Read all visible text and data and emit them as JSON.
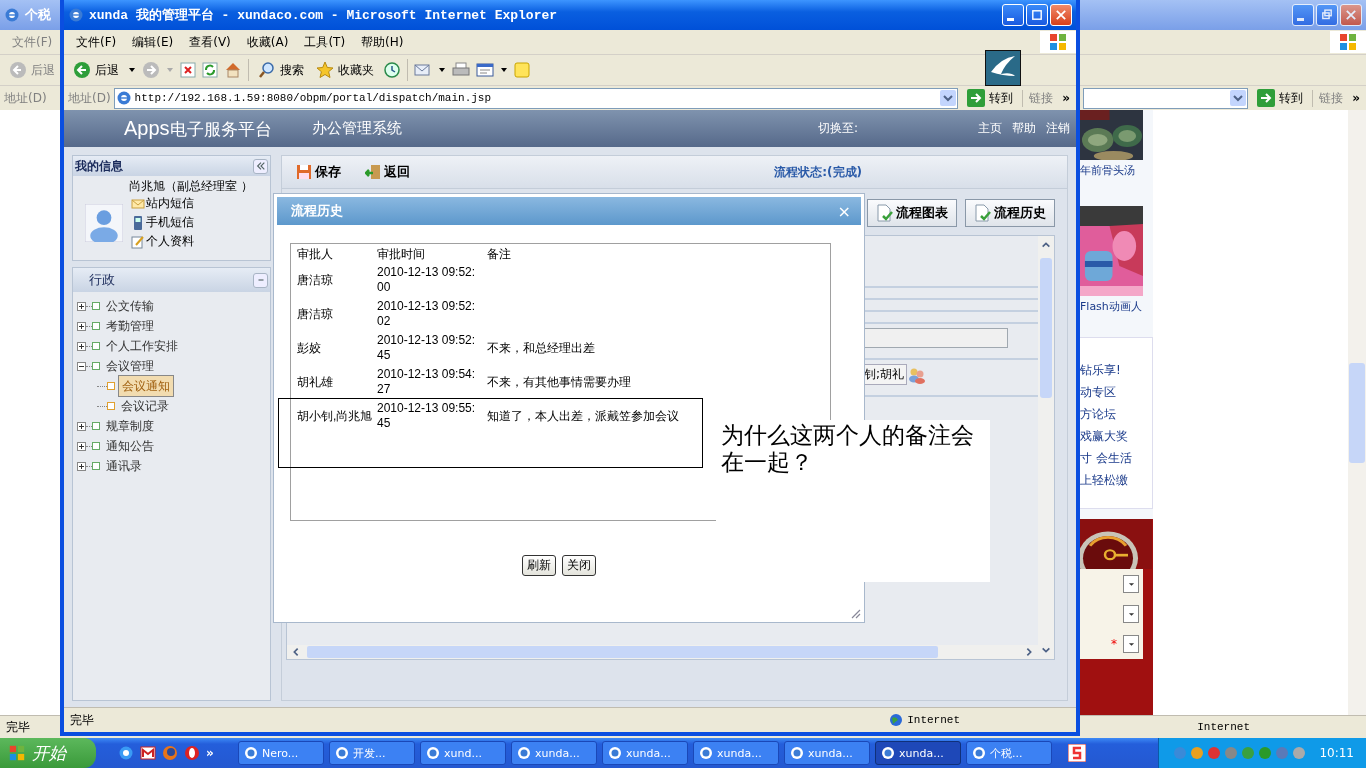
{
  "back_window": {
    "title": "个税",
    "menu": [
      "文件(F)"
    ],
    "back": "后退",
    "address_label": "地址(D)",
    "go": "转到",
    "links": "链接",
    "links_more": "»",
    "news": {
      "captions": [
        "年前骨头汤",
        "Flash动画人"
      ],
      "links": [
        "钻乐享!",
        "动专区",
        "方论坛",
        "戏赢大奖",
        "寸 会生活",
        "上轻松缴"
      ],
      "selects": [
        {
          "kind": "plain"
        },
        {
          "kind": "plain"
        },
        {
          "kind": "required",
          "mark": "*"
        }
      ]
    },
    "status": "完毕",
    "zone": "Internet"
  },
  "window": {
    "title": "xunda 我的管理平台 - xundaco.com - Microsoft Internet Explorer",
    "menu": [
      "文件(F)",
      "编辑(E)",
      "查看(V)",
      "收藏(A)",
      "工具(T)",
      "帮助(H)"
    ],
    "back": "后退",
    "search": "搜索",
    "favorites": "收藏夹",
    "address_label": "地址(D)",
    "url": "http://192.168.1.59:8080/obpm/portal/dispatch/main.jsp",
    "go": "转到",
    "links": "链接",
    "links_more": "»",
    "status": "完毕",
    "zone": "Internet"
  },
  "app": {
    "brand_latin": "Apps",
    "brand": "电子服务平台",
    "system": "办公管理系统",
    "switch_label": "切换至:",
    "nav": [
      "主页",
      "帮助",
      "注销"
    ],
    "my_info": {
      "title": "我的信息",
      "user": "尚兆旭（副总经理室 ）",
      "links": [
        {
          "kind": "mail",
          "label": "站内短信"
        },
        {
          "kind": "phone",
          "label": "手机短信"
        },
        {
          "kind": "profile",
          "label": "个人资料"
        }
      ]
    },
    "menu_panel": {
      "title": "行政",
      "tree": [
        {
          "label": "公文传输",
          "expanded": false,
          "selected": false
        },
        {
          "label": "考勤管理",
          "expanded": false,
          "selected": false
        },
        {
          "label": "个人工作安排",
          "expanded": false,
          "selected": false
        },
        {
          "label": "会议管理",
          "expanded": true,
          "selected": false,
          "children": [
            {
              "label": "会议通知",
              "selected": true
            },
            {
              "label": "会议记录",
              "selected": false
            }
          ]
        },
        {
          "label": "规章制度",
          "expanded": false,
          "selected": false
        },
        {
          "label": "通知公告",
          "expanded": false,
          "selected": false
        },
        {
          "label": "通讯录",
          "expanded": false,
          "selected": false
        }
      ]
    },
    "toolbar": [
      {
        "kind": "save",
        "label": "保存"
      },
      {
        "kind": "back",
        "label": "返回"
      }
    ],
    "flow_status": "流程状态:(完成)",
    "flow_buttons": [
      "流程图表",
      "流程历史"
    ],
    "participants": "钊;胡礼"
  },
  "dialog": {
    "title": "流程历史",
    "close": "×",
    "columns": [
      "审批人",
      "审批时间",
      "备注"
    ],
    "rows": [
      {
        "approver": "唐洁琼",
        "time": "2010-12-13 09:52:00"
      },
      {
        "approver": "唐洁琼",
        "time": "2010-12-13 09:52:02"
      },
      {
        "approver": "彭姣",
        "time": "2010-12-13 09:52:45",
        "remark": "不来，和总经理出差"
      },
      {
        "approver": "胡礼雄",
        "time": "2010-12-13 09:54:27",
        "remark": "不来，有其他事情需要办理"
      },
      {
        "approver": "胡小钊,尚兆旭",
        "time": "2010-12-13 09:55:45",
        "remark": "知道了，本人出差，派戴笠参加会议"
      }
    ],
    "buttons": [
      "刷新",
      "关闭"
    ]
  },
  "annotation": {
    "note": "为什么这两个人的备注会在一起？"
  },
  "taskbar": {
    "start": "开始",
    "quick_more": "»",
    "tasks": [
      {
        "label": "Nero...",
        "selected": false
      },
      {
        "label": "开发...",
        "selected": false
      },
      {
        "label": "xund...",
        "selected": false
      },
      {
        "label": "xunda...",
        "selected": false
      },
      {
        "label": "xunda...",
        "selected": false
      },
      {
        "label": "xunda...",
        "selected": false
      },
      {
        "label": "xunda...",
        "selected": false
      },
      {
        "label": "xunda...",
        "selected": true
      },
      {
        "label": "个税...",
        "selected": false
      }
    ],
    "clock": "10:11"
  }
}
